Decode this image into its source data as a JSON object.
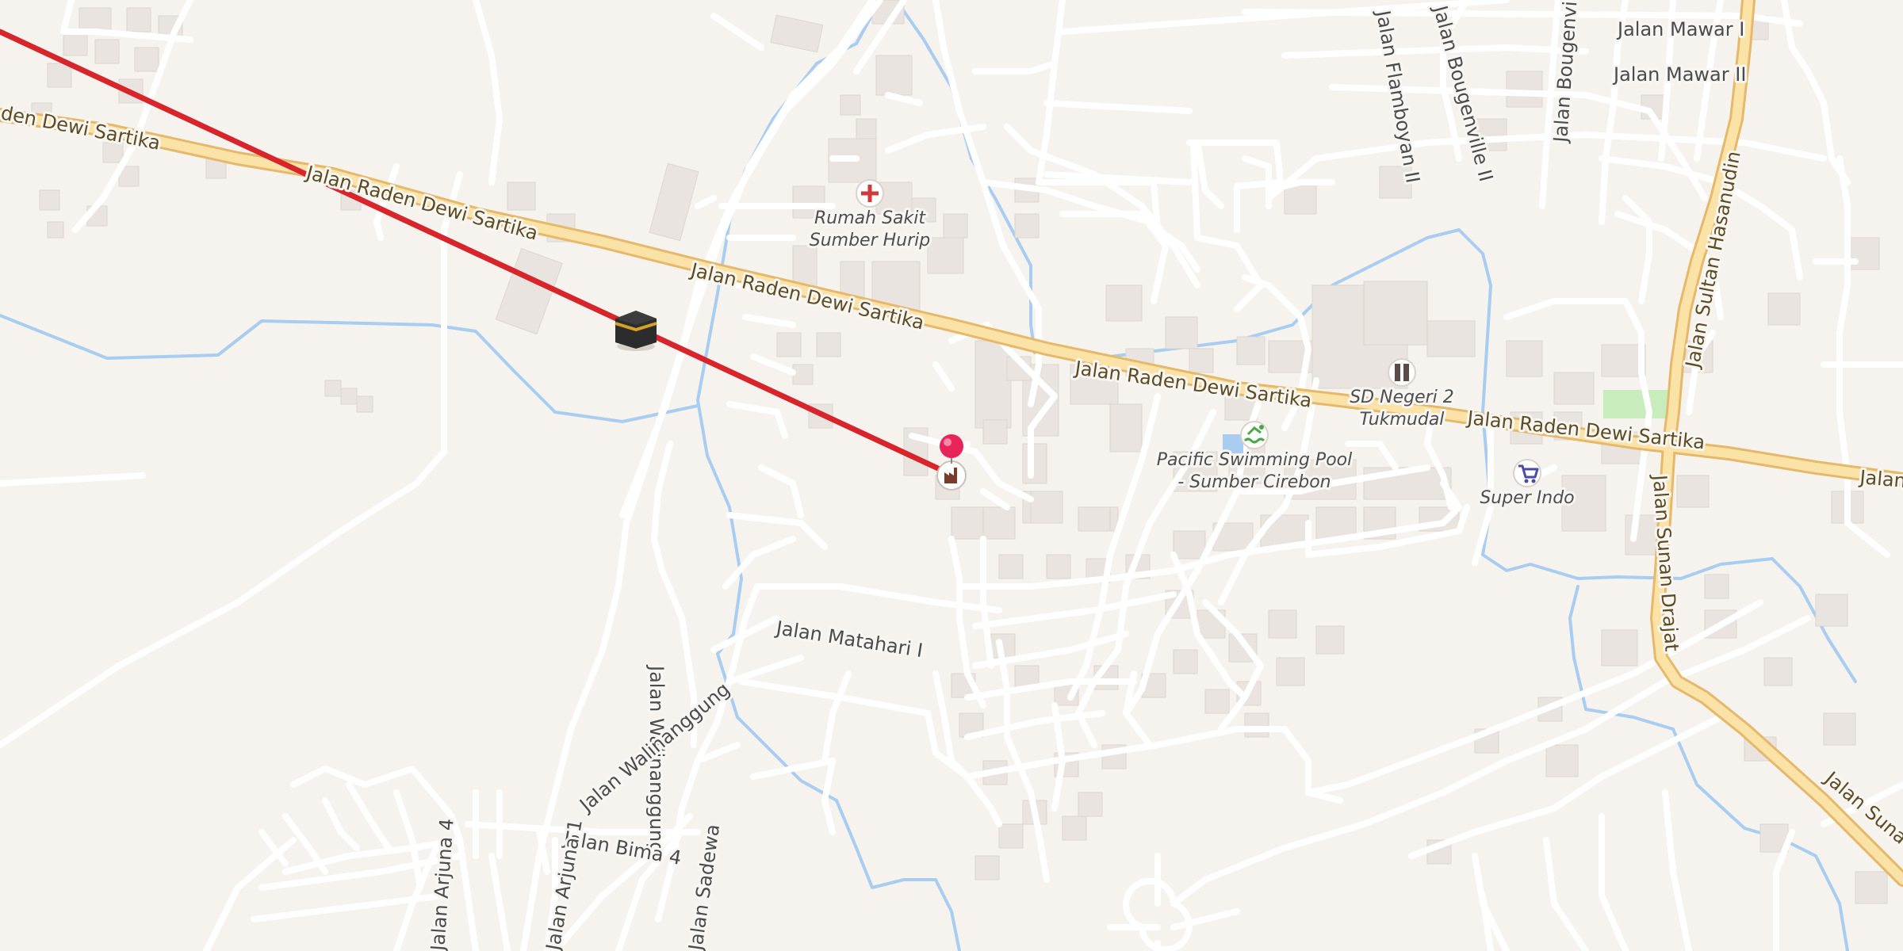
{
  "map": {
    "colors": {
      "background": "#f6f3ef",
      "road_minor": "#ffffff",
      "road_major_fill": "#fbe3a8",
      "road_major_casing": "#e6b86a",
      "water": "#a8cdf0",
      "building": "#e9e4df",
      "park": "#c9ecbc",
      "qibla_line": "#d8242b",
      "pin": "#e8245a"
    },
    "streets": {
      "dewi_sartika_1": "Jalan Raden Dewi Sartika",
      "dewi_sartika_2": "Jalan Raden Dewi Sartika",
      "dewi_sartika_3": "Jalan Raden Dewi Sartika",
      "dewi_sartika_4": "Jalan Raden Dewi Sartika",
      "dewi_sartika_5": "Jalan Raden Dewi Sartika",
      "dewi_sartika_edge_left": "den Dewi Sartika",
      "dewi_sartika_edge_right": "Jalan",
      "mawar_1": "Jalan Mawar I",
      "mawar_2": "Jalan Mawar II",
      "flamboyan": "Jalan Flamboyan II",
      "bougenville_2": "Jalan Bougenville II",
      "bougenville": "Jalan Bougenvil",
      "sultan_hasanudin": "Jalan Sultan Hasanudin",
      "sunan_drajat": "Jalan Sunan Drajat",
      "sunan_edge": "Jalan Suna",
      "matahari": "Jalan Matahari I",
      "walinanggung": "Jalan Walinanggung",
      "bima": "Jalan Bima 4",
      "arjuna_4": "Jalan Arjuna 4",
      "arjuna_1": "Jalan Arjuna 1",
      "sadewa": "Jalan Sadewa"
    },
    "pois": {
      "hospital": {
        "name_line1": "Rumah Sakit",
        "name_line2": "Sumber Hurip",
        "icon": "hospital-cross-icon"
      },
      "school": {
        "name_line1": "SD Negeri 2",
        "name_line2": "Tukmudal",
        "icon": "school-icon"
      },
      "pool": {
        "name_line1": "Pacific Swimming Pool",
        "name_line2": "- Sumber Cirebon",
        "icon": "swimming-icon"
      },
      "supermarket": {
        "name": "Super Indo",
        "icon": "shopping-cart-icon"
      },
      "current_location": {
        "icon": "factory-icon"
      },
      "kaaba": {
        "icon": "kaaba-icon"
      }
    }
  }
}
